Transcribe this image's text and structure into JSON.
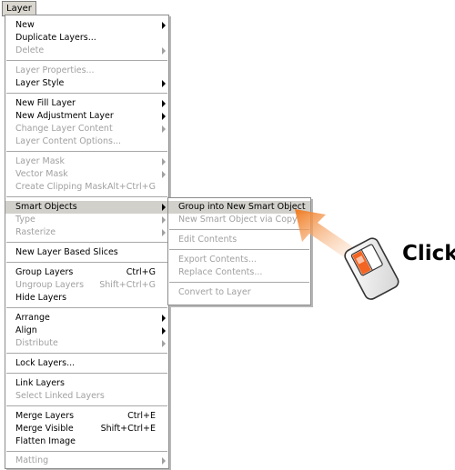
{
  "menubar": {
    "layer_label": "Layer"
  },
  "menu": {
    "items": [
      {
        "label": "New",
        "shortcut": "",
        "submenu": true,
        "disabled": false
      },
      {
        "label": "Duplicate Layers...",
        "shortcut": "",
        "submenu": false,
        "disabled": false
      },
      {
        "label": "Delete",
        "shortcut": "",
        "submenu": true,
        "disabled": true
      },
      {
        "label": "Layer Properties...",
        "shortcut": "",
        "submenu": false,
        "disabled": true
      },
      {
        "label": "Layer Style",
        "shortcut": "",
        "submenu": true,
        "disabled": false
      },
      {
        "label": "New Fill Layer",
        "shortcut": "",
        "submenu": true,
        "disabled": false
      },
      {
        "label": "New Adjustment Layer",
        "shortcut": "",
        "submenu": true,
        "disabled": false
      },
      {
        "label": "Change Layer Content",
        "shortcut": "",
        "submenu": true,
        "disabled": true
      },
      {
        "label": "Layer Content Options...",
        "shortcut": "",
        "submenu": false,
        "disabled": true
      },
      {
        "label": "Layer Mask",
        "shortcut": "",
        "submenu": true,
        "disabled": true
      },
      {
        "label": "Vector Mask",
        "shortcut": "",
        "submenu": true,
        "disabled": true
      },
      {
        "label": "Create Clipping Mask",
        "shortcut": "Alt+Ctrl+G",
        "submenu": false,
        "disabled": true
      },
      {
        "label": "Smart Objects",
        "shortcut": "",
        "submenu": true,
        "disabled": false,
        "highlighted": true
      },
      {
        "label": "Type",
        "shortcut": "",
        "submenu": true,
        "disabled": true
      },
      {
        "label": "Rasterize",
        "shortcut": "",
        "submenu": true,
        "disabled": true
      },
      {
        "label": "New Layer Based Slices",
        "shortcut": "",
        "submenu": false,
        "disabled": false
      },
      {
        "label": "Group Layers",
        "shortcut": "Ctrl+G",
        "submenu": false,
        "disabled": false
      },
      {
        "label": "Ungroup Layers",
        "shortcut": "Shift+Ctrl+G",
        "submenu": false,
        "disabled": true
      },
      {
        "label": "Hide Layers",
        "shortcut": "",
        "submenu": false,
        "disabled": false
      },
      {
        "label": "Arrange",
        "shortcut": "",
        "submenu": true,
        "disabled": false
      },
      {
        "label": "Align",
        "shortcut": "",
        "submenu": true,
        "disabled": false
      },
      {
        "label": "Distribute",
        "shortcut": "",
        "submenu": true,
        "disabled": true
      },
      {
        "label": "Lock Layers...",
        "shortcut": "",
        "submenu": false,
        "disabled": false
      },
      {
        "label": "Link Layers",
        "shortcut": "",
        "submenu": false,
        "disabled": false
      },
      {
        "label": "Select Linked Layers",
        "shortcut": "",
        "submenu": false,
        "disabled": true
      },
      {
        "label": "Merge Layers",
        "shortcut": "Ctrl+E",
        "submenu": false,
        "disabled": false
      },
      {
        "label": "Merge Visible",
        "shortcut": "Shift+Ctrl+E",
        "submenu": false,
        "disabled": false
      },
      {
        "label": "Flatten Image",
        "shortcut": "",
        "submenu": false,
        "disabled": false
      },
      {
        "label": "Matting",
        "shortcut": "",
        "submenu": true,
        "disabled": true
      }
    ]
  },
  "submenu": {
    "items": [
      {
        "label": "Group into New Smart Object",
        "disabled": false,
        "highlighted": true
      },
      {
        "label": "New Smart Object via Copy",
        "disabled": true
      },
      {
        "label": "Edit Contents",
        "disabled": true
      },
      {
        "label": "Export Contents...",
        "disabled": true
      },
      {
        "label": "Replace Contents...",
        "disabled": true
      },
      {
        "label": "Convert to Layer",
        "disabled": true
      }
    ]
  },
  "annotation": {
    "click_label": "Click",
    "arrow_color": "#f07a1e",
    "mouse_button_color": "#f26522"
  },
  "colors": {
    "highlight": "#d1d0cb",
    "disabled_text": "#a0a0a0"
  }
}
